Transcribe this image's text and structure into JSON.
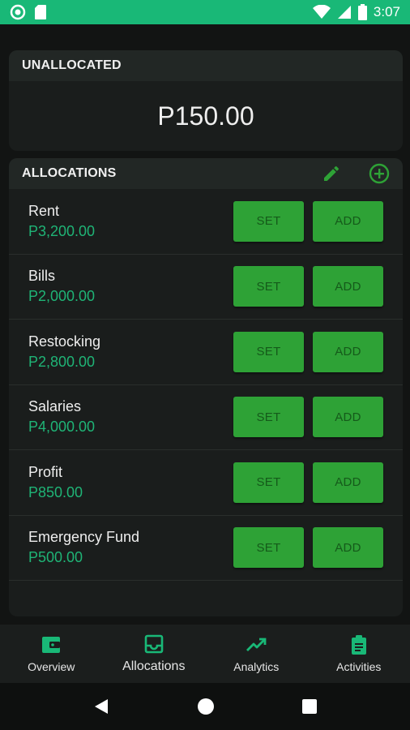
{
  "status_bar": {
    "time": "3:07"
  },
  "unallocated": {
    "title": "UNALLOCATED",
    "amount": "P150.00"
  },
  "allocations": {
    "title": "ALLOCATIONS",
    "items": [
      {
        "name": "Rent",
        "amount": "P3,200.00",
        "set_label": "SET",
        "add_label": "ADD"
      },
      {
        "name": "Bills",
        "amount": "P2,000.00",
        "set_label": "SET",
        "add_label": "ADD"
      },
      {
        "name": "Restocking",
        "amount": "P2,800.00",
        "set_label": "SET",
        "add_label": "ADD"
      },
      {
        "name": "Salaries",
        "amount": "P4,000.00",
        "set_label": "SET",
        "add_label": "ADD"
      },
      {
        "name": "Profit",
        "amount": "P850.00",
        "set_label": "SET",
        "add_label": "ADD"
      },
      {
        "name": "Emergency Fund",
        "amount": "P500.00",
        "set_label": "SET",
        "add_label": "ADD"
      }
    ]
  },
  "bottom_nav": {
    "items": [
      {
        "label": "Overview",
        "icon": "wallet-icon"
      },
      {
        "label": "Allocations",
        "icon": "inbox-icon",
        "active": true
      },
      {
        "label": "Analytics",
        "icon": "trending-up-icon"
      },
      {
        "label": "Activities",
        "icon": "clipboard-icon"
      }
    ]
  },
  "colors": {
    "accent": "#19b877",
    "button": "#2ea236",
    "amount": "#1fb476",
    "background": "#121413"
  }
}
